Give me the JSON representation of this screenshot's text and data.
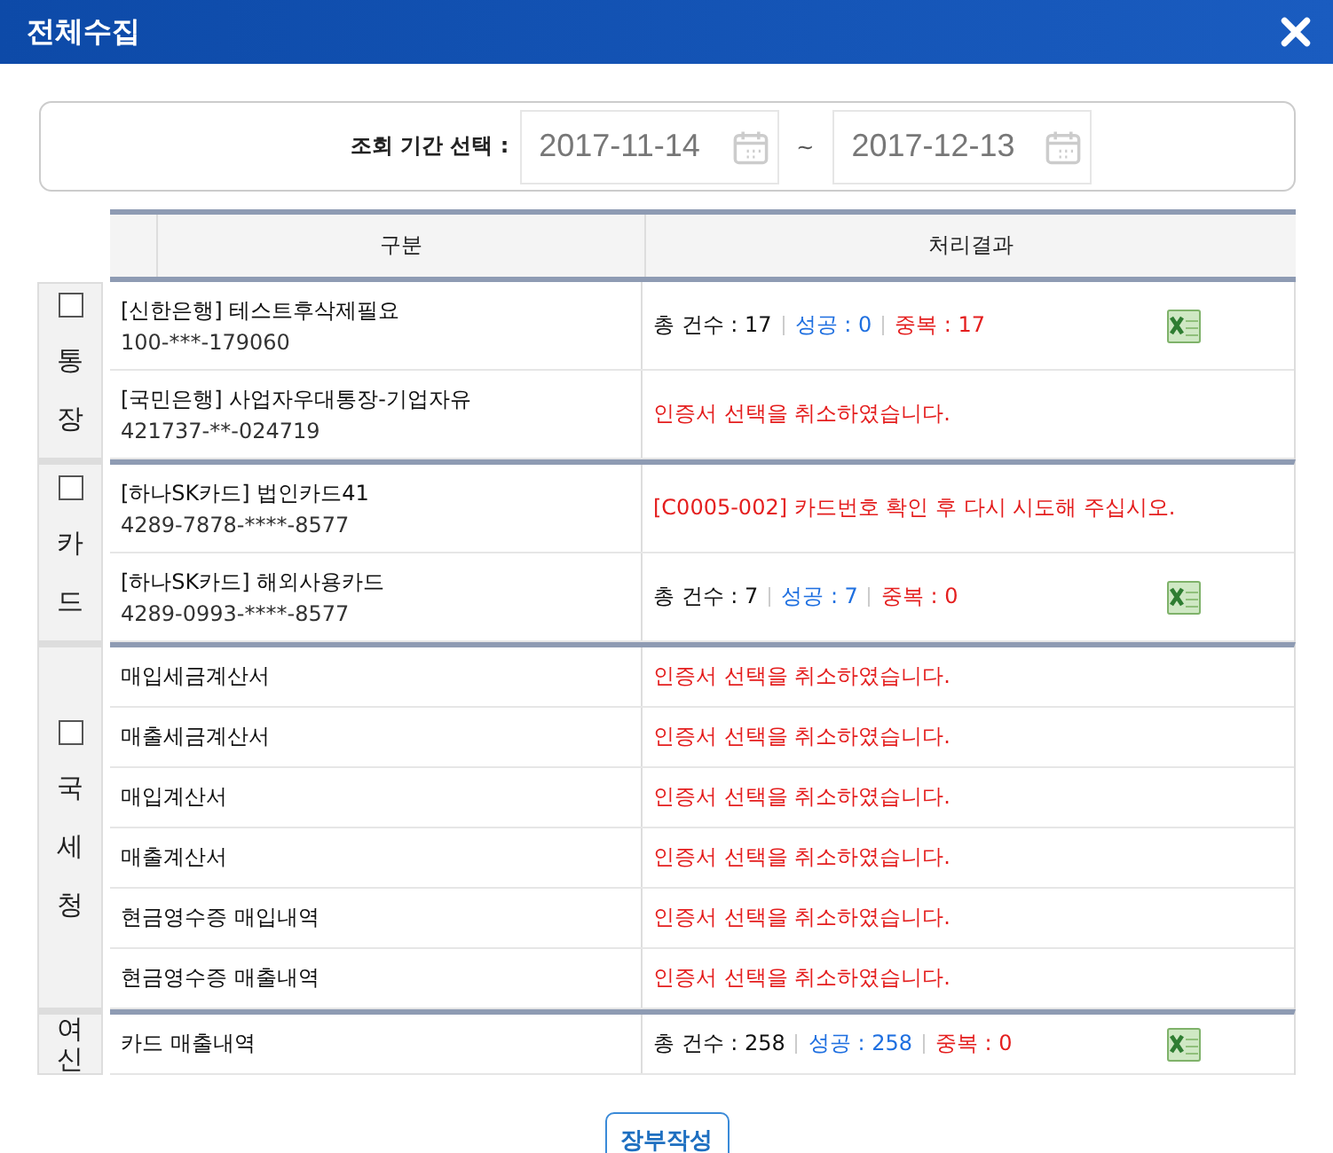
{
  "window": {
    "title": "전체수집"
  },
  "period": {
    "label": "조회 기간 선택 :",
    "from": "2017-11-14",
    "separator": "~",
    "to": "2017-12-13"
  },
  "table": {
    "columns": [
      "구분",
      "처리결과"
    ],
    "groups": [
      {
        "label": "통장",
        "checked": false,
        "rows": [
          {
            "name": "[신한은행] 테스트후삭제필요",
            "number": "100-***-179060",
            "result": {
              "kind": "counts",
              "total": "총 건수 : 17",
              "success": "성공 : 0",
              "duplicate": "중복 : 17",
              "excel": true
            }
          },
          {
            "name": "[국민은행] 사업자우대통장-기업자유",
            "number": "421737-**-024719",
            "result": {
              "kind": "error",
              "message": "인증서 선택을 취소하였습니다."
            }
          }
        ]
      },
      {
        "label": "카드",
        "checked": false,
        "rows": [
          {
            "name": "[하나SK카드] 법인카드41",
            "number": "4289-7878-****-8577",
            "result": {
              "kind": "error",
              "message": "[C0005-002] 카드번호 확인 후 다시 시도해 주십시오."
            }
          },
          {
            "name": "[하나SK카드] 해외사용카드",
            "number": "4289-0993-****-8577",
            "result": {
              "kind": "counts",
              "total": "총 건수 : 7",
              "success": "성공 : 7",
              "duplicate": "중복 : 0",
              "excel": true
            }
          }
        ]
      },
      {
        "label": "국세청",
        "checked": false,
        "rows": [
          {
            "name": "매입세금계산서",
            "result": {
              "kind": "error",
              "message": "인증서 선택을 취소하였습니다."
            }
          },
          {
            "name": "매출세금계산서",
            "result": {
              "kind": "error",
              "message": "인증서 선택을 취소하였습니다."
            }
          },
          {
            "name": "매입계산서",
            "result": {
              "kind": "error",
              "message": "인증서 선택을 취소하였습니다."
            }
          },
          {
            "name": "매출계산서",
            "result": {
              "kind": "error",
              "message": "인증서 선택을 취소하였습니다."
            }
          },
          {
            "name": "현금영수증 매입내역",
            "result": {
              "kind": "error",
              "message": "인증서 선택을 취소하였습니다."
            }
          },
          {
            "name": "현금영수증 매출내역",
            "result": {
              "kind": "error",
              "message": "인증서 선택을 취소하였습니다."
            }
          }
        ]
      },
      {
        "label": "여신",
        "rows": [
          {
            "name": "카드 매출내역",
            "result": {
              "kind": "counts",
              "total": "총 건수 : 258",
              "success": "성공 : 258",
              "duplicate": "중복 : 0",
              "excel": true
            }
          }
        ]
      }
    ]
  },
  "buttons": [
    "장부작성"
  ]
}
